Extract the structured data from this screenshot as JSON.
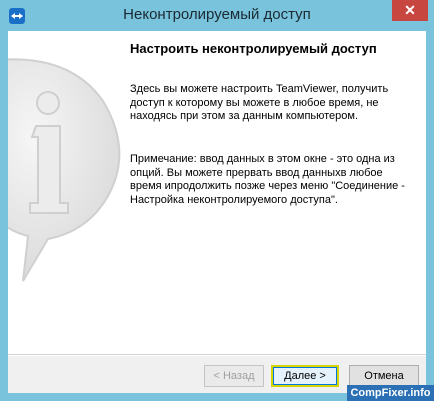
{
  "window": {
    "title": "Неконтролируемый доступ",
    "close_label": "✕"
  },
  "content": {
    "heading": "Настроить неконтролируемый доступ",
    "paragraph1": "Здесь вы можете настроить TeamViewer, получить доступ к которому вы можете в любое время, не находясь при этом за данным компьютером.",
    "paragraph2": "Примечание: ввод данных в этом окне  - это одна из опций. Вы можете прервать ввод данныхв любое время ипродолжить позже через меню \"Соединение - Настройка неконтролируемого доступа\"."
  },
  "buttons": {
    "back_label": "< Назад",
    "next_label": "Далее >",
    "cancel_label": "Отмена"
  },
  "watermark": {
    "text": "CompFixer.info"
  },
  "colors": {
    "titlebar": "#7ac3dc",
    "close": "#c7463f",
    "accent": "#0078d7"
  },
  "icons": {
    "app": "teamviewer-icon",
    "graphic": "info-bubble-icon"
  }
}
